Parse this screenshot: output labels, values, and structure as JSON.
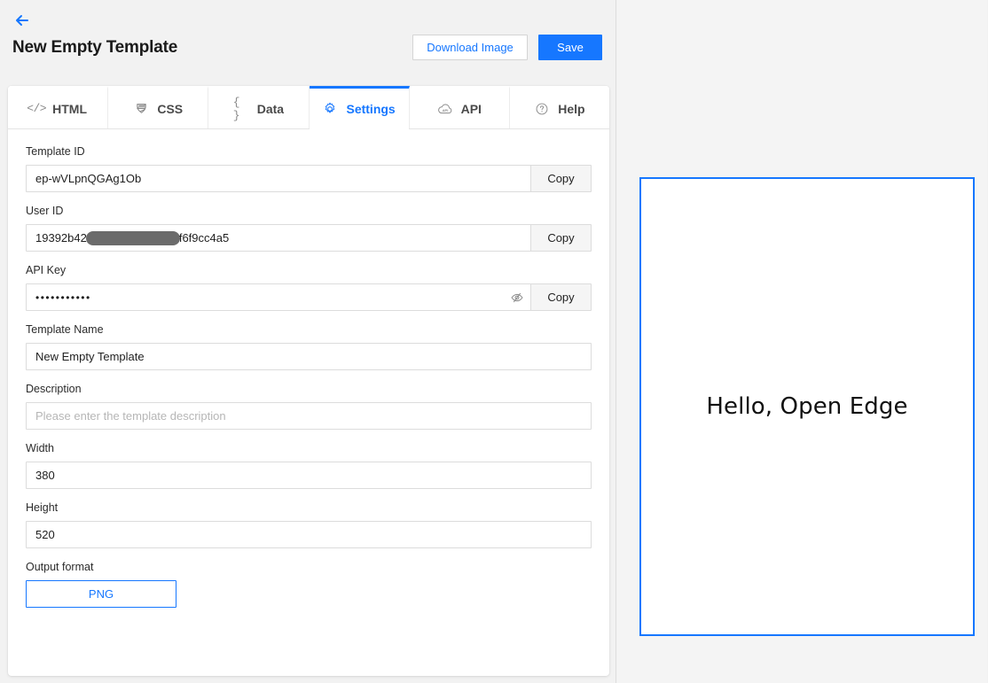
{
  "header": {
    "back_icon": "arrow-left-icon",
    "title": "New Empty Template",
    "download_label": "Download Image",
    "save_label": "Save"
  },
  "tabs": [
    {
      "label": "HTML",
      "icon": "code-icon",
      "glyph": "</>",
      "active": false
    },
    {
      "label": "CSS",
      "icon": "css-icon",
      "glyph": "",
      "active": false
    },
    {
      "label": "Data",
      "icon": "braces-icon",
      "glyph": "{ }",
      "active": false
    },
    {
      "label": "Settings",
      "icon": "gear-icon",
      "glyph": "",
      "active": true
    },
    {
      "label": "API",
      "icon": "cloud-api-icon",
      "glyph": "",
      "active": false
    },
    {
      "label": "Help",
      "icon": "question-circle-icon",
      "glyph": "",
      "active": false
    }
  ],
  "form": {
    "template_id": {
      "label": "Template ID",
      "value": "ep-wVLpnQGAg1Ob",
      "copy_label": "Copy"
    },
    "user_id": {
      "label": "User ID",
      "value_prefix": "19392b42",
      "value_suffix": "f6f9cc4a5",
      "redacted": true,
      "copy_label": "Copy"
    },
    "api_key": {
      "label": "API Key",
      "value": "•••••••••••",
      "masked": true,
      "toggle_icon": "eye-slash-icon",
      "copy_label": "Copy"
    },
    "template_name": {
      "label": "Template Name",
      "value": "New Empty Template"
    },
    "description": {
      "label": "Description",
      "value": "",
      "placeholder": "Please enter the template description"
    },
    "width": {
      "label": "Width",
      "value": "380"
    },
    "height": {
      "label": "Height",
      "value": "520"
    },
    "output_format": {
      "label": "Output format",
      "selected": "PNG"
    }
  },
  "preview": {
    "text": "Hello, Open Edge"
  },
  "colors": {
    "accent": "#1677ff",
    "page_bg": "#f2f2f2",
    "card_bg": "#ffffff",
    "border": "#dcdcdc",
    "muted_text": "#8a8a8a",
    "redaction": "#6b6b6b"
  }
}
